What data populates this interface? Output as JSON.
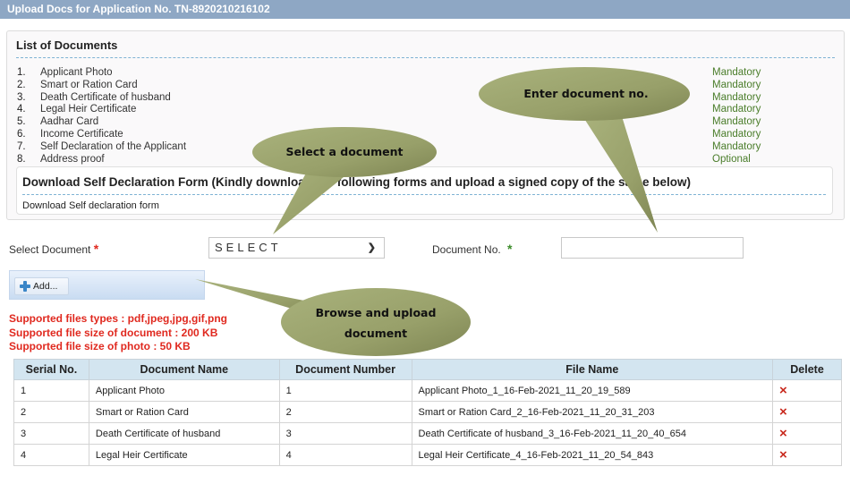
{
  "title": "Upload Docs for Application No. TN-8920210216102",
  "list_of_documents": {
    "heading": "List of Documents",
    "items": [
      {
        "num": "1.",
        "name": "Applicant Photo",
        "requirement": "Mandatory"
      },
      {
        "num": "2.",
        "name": "Smart or Ration Card",
        "requirement": "Mandatory"
      },
      {
        "num": "3.",
        "name": "Death Certificate of husband",
        "requirement": "Mandatory"
      },
      {
        "num": "4.",
        "name": "Legal Heir Certificate",
        "requirement": "Mandatory"
      },
      {
        "num": "5.",
        "name": "Aadhar Card",
        "requirement": "Mandatory"
      },
      {
        "num": "6.",
        "name": "Income Certificate",
        "requirement": "Mandatory"
      },
      {
        "num": "7.",
        "name": "Self Declaration of the Applicant",
        "requirement": "Mandatory"
      },
      {
        "num": "8.",
        "name": "Address proof",
        "requirement": "Optional"
      }
    ]
  },
  "self_declaration": {
    "heading": "Download Self Declaration Form (Kindly download the following forms and upload a signed copy of the same below)",
    "link": "Download Self declaration form"
  },
  "form": {
    "select_document_label": "Select Document",
    "select_document_value": "SELECT",
    "document_no_label": "Document No.",
    "document_no_value": "",
    "required_marker": "*",
    "add_button": "Add..."
  },
  "info": [
    "Supported files types : pdf,jpeg,jpg,gif,png",
    "Supported file size of document : 200 KB",
    "Supported file size of photo : 50 KB"
  ],
  "table": {
    "headers": [
      "Serial No.",
      "Document Name",
      "Document Number",
      "File Name",
      "Delete"
    ],
    "rows": [
      {
        "serial": "1",
        "name": "Applicant Photo",
        "number": "1",
        "file": "Applicant Photo_1_16-Feb-2021_11_20_19_589"
      },
      {
        "serial": "2",
        "name": "Smart or Ration Card",
        "number": "2",
        "file": "Smart or Ration Card_2_16-Feb-2021_11_20_31_203"
      },
      {
        "serial": "3",
        "name": "Death Certificate of husband",
        "number": "3",
        "file": "Death Certificate of husband_3_16-Feb-2021_11_20_40_654"
      },
      {
        "serial": "4",
        "name": "Legal Heir Certificate",
        "number": "4",
        "file": "Legal Heir Certificate_4_16-Feb-2021_11_20_54_843"
      }
    ],
    "delete_icon": "×"
  },
  "callouts": {
    "select_document": "Select a document",
    "enter_document_no": "Enter document no.",
    "browse_upload_line1": "Browse and upload",
    "browse_upload_line2": "document"
  },
  "colors": {
    "title_bar": "#8ea7c4",
    "mandatory_text": "#4a7d2a",
    "info_text": "#e0291f",
    "table_header": "#d3e5f0",
    "callout_fill": "#9aa36e",
    "delete_icon": "#c8281c"
  }
}
